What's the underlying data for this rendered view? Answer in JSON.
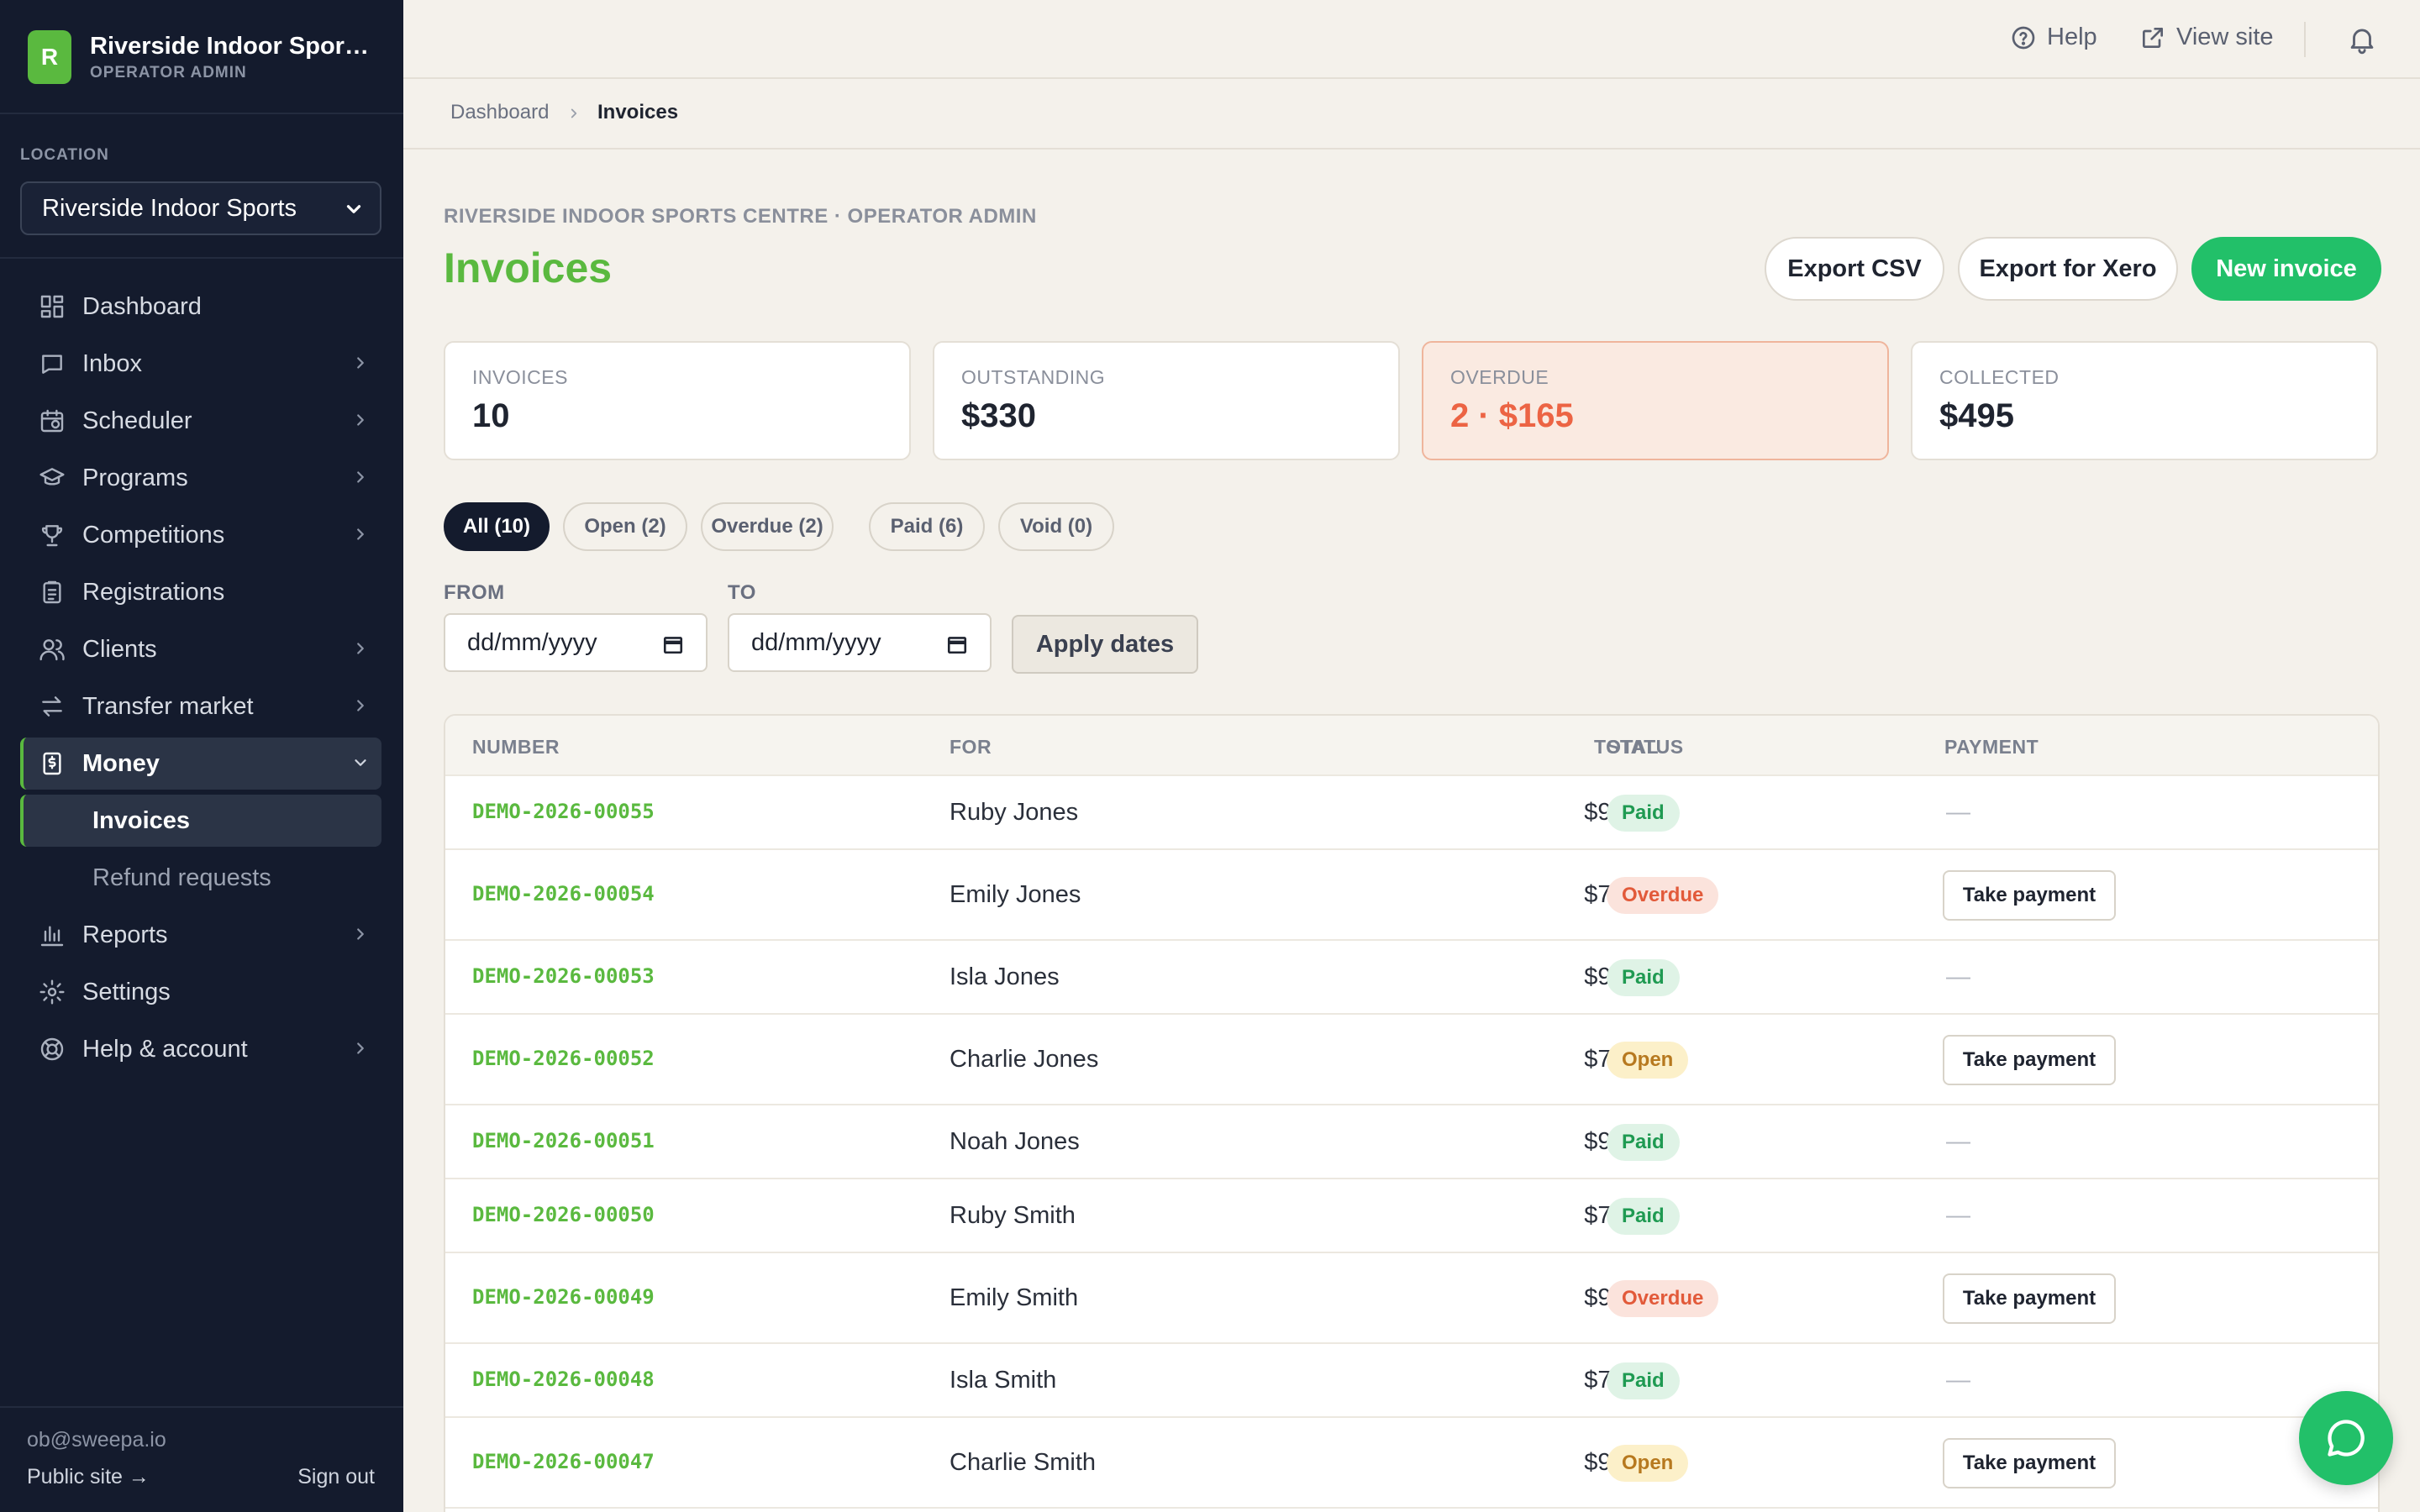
{
  "brand": {
    "logo_letter": "R",
    "title": "Riverside Indoor Sports Centre",
    "subtitle": "OPERATOR ADMIN"
  },
  "location": {
    "label": "LOCATION",
    "selected": "Riverside Indoor Sports"
  },
  "nav": [
    {
      "label": "Dashboard",
      "icon": "dashboard-icon",
      "has_arrow": false
    },
    {
      "label": "Inbox",
      "icon": "inbox-icon",
      "has_arrow": true
    },
    {
      "label": "Scheduler",
      "icon": "calendar-icon",
      "has_arrow": true
    },
    {
      "label": "Programs",
      "icon": "graduation-cap-icon",
      "has_arrow": true
    },
    {
      "label": "Competitions",
      "icon": "trophy-icon",
      "has_arrow": true
    },
    {
      "label": "Registrations",
      "icon": "clipboard-icon",
      "has_arrow": false
    },
    {
      "label": "Clients",
      "icon": "users-icon",
      "has_arrow": true
    },
    {
      "label": "Transfer market",
      "icon": "transfer-icon",
      "has_arrow": true
    },
    {
      "label": "Money",
      "icon": "money-icon",
      "expanded": true,
      "children": [
        "Invoices",
        "Refund requests"
      ]
    },
    {
      "label": "Reports",
      "icon": "bar-chart-icon",
      "has_arrow": true
    },
    {
      "label": "Settings",
      "icon": "gear-icon",
      "has_arrow": false
    },
    {
      "label": "Help & account",
      "icon": "lifebuoy-icon",
      "has_arrow": true
    }
  ],
  "footer": {
    "email": "ob@sweepa.io",
    "public_site": "Public site →",
    "sign_out": "Sign out"
  },
  "topbar": {
    "help": "Help",
    "view_site": "View site"
  },
  "breadcrumb": {
    "parent": "Dashboard",
    "current": "Invoices"
  },
  "header": {
    "eyebrow": "RIVERSIDE INDOOR SPORTS CENTRE · OPERATOR ADMIN",
    "title": "Invoices",
    "export_csv": "Export CSV",
    "export_xero": "Export for Xero",
    "new_invoice": "New invoice"
  },
  "stats": [
    {
      "label": "INVOICES",
      "value": "10"
    },
    {
      "label": "OUTSTANDING",
      "value": "$330"
    },
    {
      "label": "OVERDUE",
      "value": "2 · $165"
    },
    {
      "label": "COLLECTED",
      "value": "$495"
    }
  ],
  "filters": [
    "All (10)",
    "Open (2)",
    "Overdue (2)",
    "Paid (6)",
    "Void (0)"
  ],
  "dates": {
    "from_label": "FROM",
    "to_label": "TO",
    "placeholder": "dd/mm/yyyy",
    "apply": "Apply dates"
  },
  "table": {
    "headers": [
      "NUMBER",
      "FOR",
      "TOTAL",
      "STATUS",
      "PAYMENT"
    ],
    "take_payment": "Take payment",
    "no_payment": "—",
    "rows": [
      {
        "number": "DEMO-2026-00055",
        "for": "Ruby Jones",
        "total": "$93.50",
        "status": "Paid"
      },
      {
        "number": "DEMO-2026-00054",
        "for": "Emily Jones",
        "total": "$71.50",
        "status": "Overdue"
      },
      {
        "number": "DEMO-2026-00053",
        "for": "Isla Jones",
        "total": "$93.50",
        "status": "Paid"
      },
      {
        "number": "DEMO-2026-00052",
        "for": "Charlie Jones",
        "total": "$71.50",
        "status": "Open"
      },
      {
        "number": "DEMO-2026-00051",
        "for": "Noah Jones",
        "total": "$93.50",
        "status": "Paid"
      },
      {
        "number": "DEMO-2026-00050",
        "for": "Ruby Smith",
        "total": "$71.50",
        "status": "Paid"
      },
      {
        "number": "DEMO-2026-00049",
        "for": "Emily Smith",
        "total": "$93.50",
        "status": "Overdue"
      },
      {
        "number": "DEMO-2026-00048",
        "for": "Isla Smith",
        "total": "$71.50",
        "status": "Paid"
      },
      {
        "number": "DEMO-2026-00047",
        "for": "Charlie Smith",
        "total": "$93.50",
        "status": "Open"
      }
    ]
  },
  "colors": {
    "accent": "#5ab93f",
    "primary_button": "#22c069",
    "sidebar": "#141b2d",
    "overdue": "#ec6444"
  }
}
